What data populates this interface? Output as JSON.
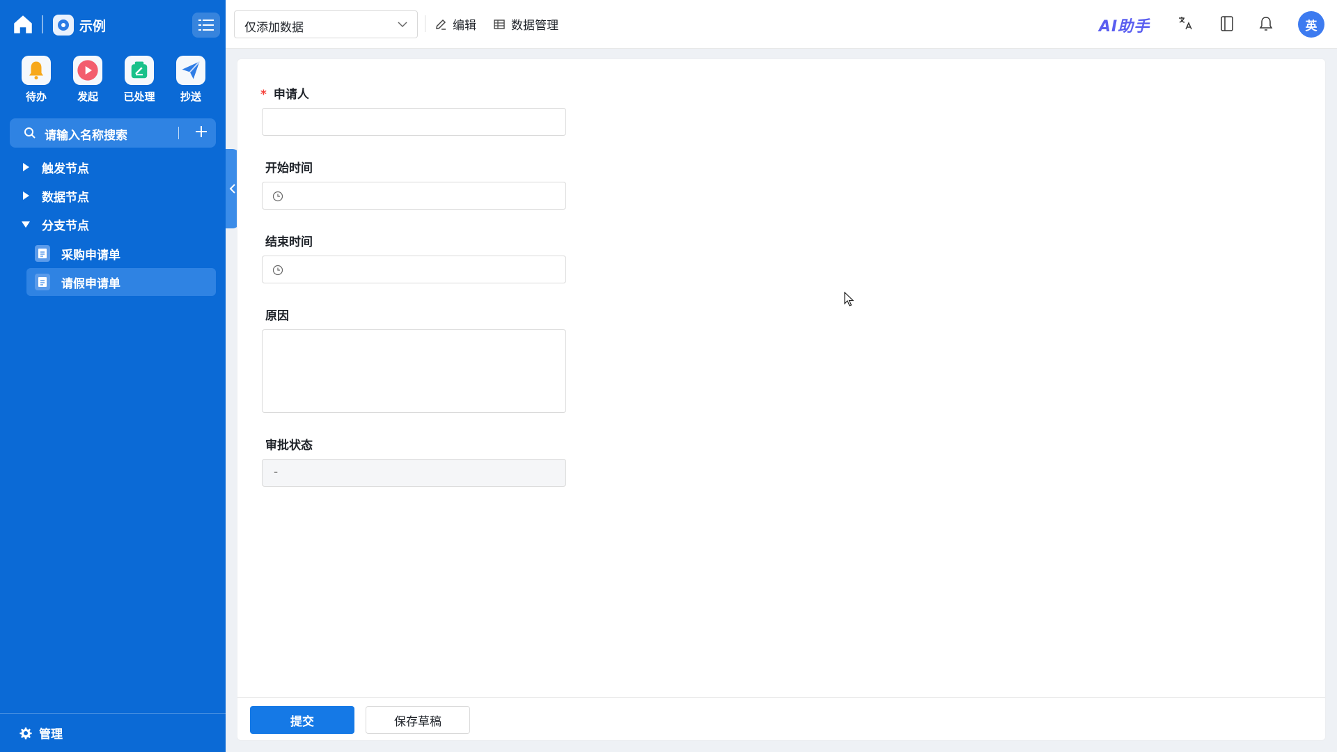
{
  "sidebar": {
    "app_name": "示例",
    "quick_actions": [
      {
        "label": "待办",
        "icon": "bell-icon"
      },
      {
        "label": "发起",
        "icon": "play-icon"
      },
      {
        "label": "已处理",
        "icon": "processed-icon"
      },
      {
        "label": "抄送",
        "icon": "send-icon"
      }
    ],
    "search_placeholder": "请输入名称搜索",
    "tree": {
      "trigger": "触发节点",
      "data": "数据节点",
      "branch": "分支节点",
      "leaves": [
        "采购申请单",
        "请假申请单"
      ]
    },
    "footer_label": "管理"
  },
  "topbar": {
    "dropdown_value": "仅添加数据",
    "edit_label": "编辑",
    "data_manage_label": "数据管理",
    "ai_label": "AI助手",
    "avatar_text": "英"
  },
  "form": {
    "fields": {
      "applicant": "申请人",
      "start_time": "开始时间",
      "end_time": "结束时间",
      "reason": "原因",
      "approval_status": "审批状态",
      "approval_status_value": "-"
    },
    "submit_label": "提交",
    "save_draft_label": "保存草稿"
  },
  "colors": {
    "sidebar": "#0b6ad6",
    "primary": "#1579e6",
    "required": "#f5413a"
  }
}
